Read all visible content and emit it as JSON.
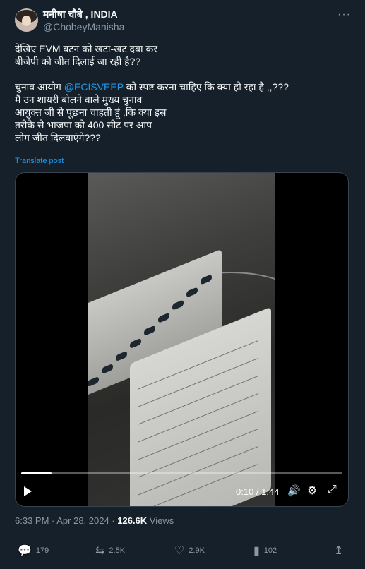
{
  "author": {
    "name": "मनीषा चौबे , INDIA",
    "handle": "@ChobeyManisha"
  },
  "tweet": {
    "line1": "देखिए EVM बटन को खटा-खट दबा कर",
    "line2": "बीजेपी को जीत दिलाई जा रही है??",
    "line3_pre": "चुनाव आयोग ",
    "line3_mention": "@ECISVEEP",
    "line3_post": " को स्पष्ट करना चाहिए कि क्या हो रहा है ,,???",
    "line4": "मैं उन शायरी बोलने वाले मुख्य चुनाव",
    "line5": "आयुक्त जी से पूछना चाहती हूं ,कि क्या इस",
    "line6": "तरीके से भाजपा को 400 सीट पर आप",
    "line7": "लोग जीत दिलवाएंगे???",
    "translate": "Translate post"
  },
  "video": {
    "time": "0:10 / 1:44",
    "progress": 0.095,
    "icons": {
      "play": "play-icon",
      "volume": "volume-icon",
      "settings": "gear-icon",
      "fullscreen": "fullscreen-icon"
    }
  },
  "meta": {
    "time": "6:33 PM · Apr 28, 2024 · ",
    "views": "126.6K",
    "views_label": " Views"
  },
  "actions": {
    "replies": "179",
    "reposts": "2.5K",
    "likes": "2.9K",
    "bookmarks": "102"
  },
  "colors": {
    "background": "#15202b",
    "accent": "#1d9bf0",
    "muted": "#8b98a5"
  }
}
